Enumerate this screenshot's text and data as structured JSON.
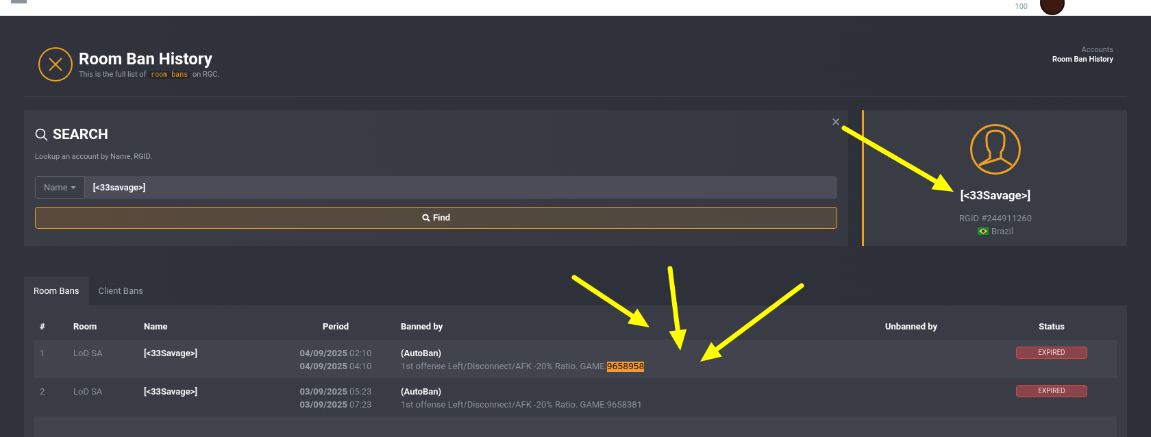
{
  "top_bar": {
    "counter": "100"
  },
  "header": {
    "title": "Room Ban History",
    "subtitle_before": "This is the full list of",
    "subtitle_code": "room bans",
    "subtitle_after": "on RGC."
  },
  "breadcrumb": [
    {
      "label": "Accounts",
      "current": false
    },
    {
      "label": "Room Ban History",
      "current": true
    }
  ],
  "search": {
    "title": "SEARCH",
    "hint": "Lookup an account by Name, RGID.",
    "close": "×",
    "field_type": "Name",
    "value": "[<33savage>]",
    "button": "Find"
  },
  "profile": {
    "name": "[<33Savage>]",
    "rgid": "RGID #244911260",
    "country": "Brazil"
  },
  "tabs": [
    {
      "label": "Room Bans",
      "selected": true
    },
    {
      "label": "Client Bans",
      "selected": false
    }
  ],
  "table": {
    "columns": [
      "#",
      "Room",
      "Name",
      "Period",
      "Banned by",
      "Unbanned by",
      "Status"
    ],
    "rows": [
      {
        "index": "1",
        "room": "LoD SA",
        "name": "[<33Savage>]",
        "start_date": "04/09/2025",
        "start_time": "02:10",
        "end_date": "04/09/2025",
        "end_time": "04:10",
        "banned_by": "(AutoBan)",
        "reason_parts": [
          {
            "text": "1st offense Left/Disconnect/AFK -20% Ratio. GAME:",
            "selected": false
          },
          {
            "text": "9658958",
            "selected": true
          }
        ],
        "unbanned_by": "",
        "status": "EXPIRED"
      },
      {
        "index": "2",
        "room": "LoD SA",
        "name": "[<33Savage>]",
        "start_date": "03/09/2025",
        "start_time": "05:23",
        "end_date": "03/09/2025",
        "end_time": "07:23",
        "banned_by": "(AutoBan)",
        "reason_parts": [
          {
            "text": "1st offense Left/Disconnect/AFK -20% Ratio. GAME:9658381",
            "selected": false
          }
        ],
        "unbanned_by": "",
        "status": "EXPIRED"
      }
    ]
  }
}
